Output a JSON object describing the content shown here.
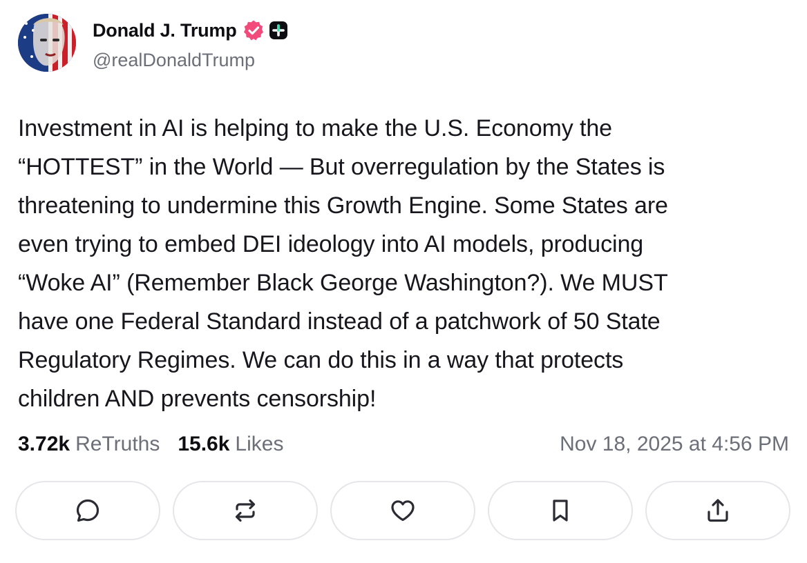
{
  "author": {
    "display_name": "Donald J. Trump",
    "handle": "@realDonaldTrump",
    "verified_color": "#f24a7a",
    "avatar_icon": "avatar-flag-portrait"
  },
  "post": {
    "text": "Investment in AI is helping to make the U.S. Economy the\n“HOTTEST” in the World — But overregulation by the States is\nthreatening to undermine this Growth Engine. Some States are\neven trying to embed DEI ideology into AI models, producing\n“Woke AI” (Remember Black George Washington?). We MUST\nhave one Federal Standard instead of a patchwork of 50 State\nRegulatory Regimes. We can do this in a way that protects\nchildren AND prevents censorship!"
  },
  "stats": {
    "retruths_count": "3.72k",
    "retruths_label": "ReTruths",
    "likes_count": "15.6k",
    "likes_label": "Likes",
    "timestamp": "Nov 18, 2025 at 4:56 PM"
  },
  "actions": [
    {
      "name": "reply",
      "icon": "comment-icon"
    },
    {
      "name": "retruth",
      "icon": "repost-icon"
    },
    {
      "name": "like",
      "icon": "heart-icon"
    },
    {
      "name": "bookmark",
      "icon": "bookmark-icon"
    },
    {
      "name": "share",
      "icon": "share-icon"
    }
  ]
}
